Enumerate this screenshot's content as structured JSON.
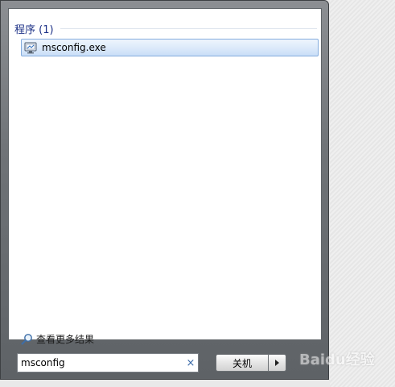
{
  "results": {
    "group_title": "程序 (1)",
    "items": [
      {
        "label": "msconfig.exe",
        "icon": "msconfig-program-icon"
      }
    ]
  },
  "see_more": {
    "label": "查看更多结果",
    "icon": "search-magnifier-icon"
  },
  "search": {
    "value": "msconfig",
    "clear_glyph": "×"
  },
  "shutdown": {
    "label": "关机",
    "arrow_icon": "triangle-right-icon"
  },
  "watermark": {
    "text": "Baidu经验"
  },
  "colors": {
    "group_title": "#1e3287",
    "selection_border": "#84acdd",
    "frame": "#6f7377"
  }
}
